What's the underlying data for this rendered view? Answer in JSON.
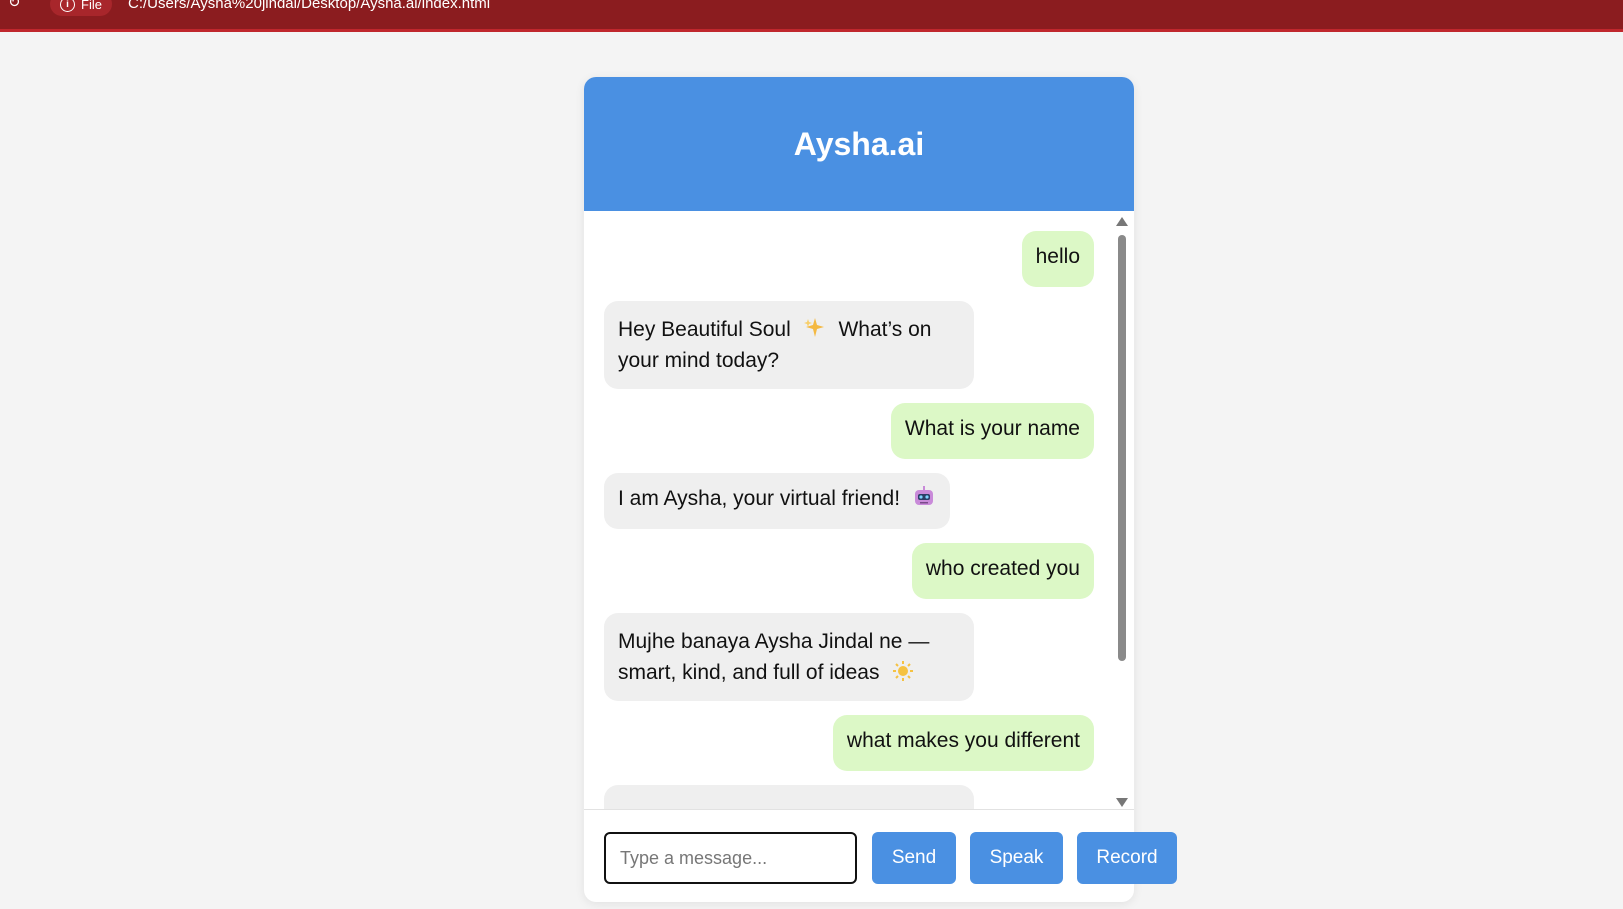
{
  "browser": {
    "site_chip_label": "File",
    "url": "C:/Users/Aysha%20jindal/Desktop/Aysha.ai/index.html"
  },
  "chat": {
    "title": "Aysha.ai",
    "messages": [
      {
        "sender": "user",
        "text": "hello"
      },
      {
        "sender": "bot",
        "line1": "Hey Beautiful Soul",
        "line1b": "What’s on",
        "line2": "your mind today?",
        "emoji": "sparkles-icon"
      },
      {
        "sender": "user",
        "text": "What is your name"
      },
      {
        "sender": "bot",
        "text": "I am Aysha, your virtual friend!",
        "emoji": "robot-icon"
      },
      {
        "sender": "user",
        "text": "who created you"
      },
      {
        "sender": "bot",
        "line1": "Mujhe banaya Aysha Jindal ne —",
        "line2": "smart, kind, and full of ideas",
        "emoji": "sun-icon"
      },
      {
        "sender": "user",
        "text": "what makes you different"
      }
    ],
    "input": {
      "placeholder": "Type a message..."
    },
    "buttons": {
      "send": "Send",
      "speak": "Speak",
      "record": "Record"
    }
  },
  "colors": {
    "browser_bar": "#8b1c1f",
    "header": "#4a90e2",
    "user_bubble": "#dcf8c6",
    "bot_bubble": "#efefef",
    "button": "#4a90e2"
  }
}
